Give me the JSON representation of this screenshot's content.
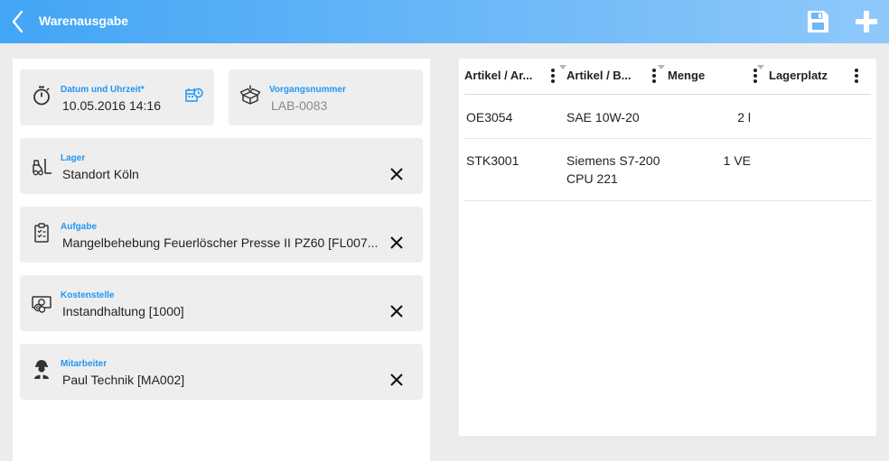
{
  "header": {
    "title": "Warenausgabe"
  },
  "form": {
    "datetime": {
      "label": "Datum und Uhrzeit*",
      "value": "10.05.2016 14:16"
    },
    "vorgang": {
      "label": "Vorgangsnummer",
      "value": "LAB-0083"
    },
    "lager": {
      "label": "Lager",
      "value": "Standort Köln"
    },
    "aufgabe": {
      "label": "Aufgabe",
      "value": "Mangelbehebung Feuerlöscher Presse  II PZ60 [FL007..."
    },
    "kostenstelle": {
      "label": "Kostenstelle",
      "value": "Instandhaltung [1000]"
    },
    "mitarbeiter": {
      "label": "Mitarbeiter",
      "value": "Paul Technik [MA002]"
    }
  },
  "table": {
    "columns": [
      "Artikel / Ar...",
      "Artikel / B...",
      "Menge",
      "Lagerplatz"
    ],
    "rows": [
      {
        "artikel": "OE3054",
        "bezeichnung": "SAE 10W-20",
        "bezeichnung2": "",
        "menge": "2 l",
        "lagerplatz": ""
      },
      {
        "artikel": "STK3001",
        "bezeichnung": "Siemens S7-200",
        "bezeichnung2": "CPU 221",
        "menge": "1 VE",
        "lagerplatz": ""
      }
    ]
  },
  "colors": {
    "accent": "#2196f3",
    "header_start": "#42a5f5",
    "header_end": "#8ec9fa",
    "field_bg": "#eeeeee"
  },
  "icons": {
    "back": "chevron-left-icon",
    "save": "floppy-disk-icon",
    "add": "plus-icon",
    "datetime": "stopwatch-icon",
    "calendar": "calendar-clock-icon",
    "vorgang": "open-box-icon",
    "lager": "forklift-icon",
    "aufgabe": "clipboard-check-icon",
    "kostenstelle": "money-icon",
    "mitarbeiter": "worker-icon",
    "clear": "close-icon",
    "column_menu": "vertical-dots-icon"
  }
}
